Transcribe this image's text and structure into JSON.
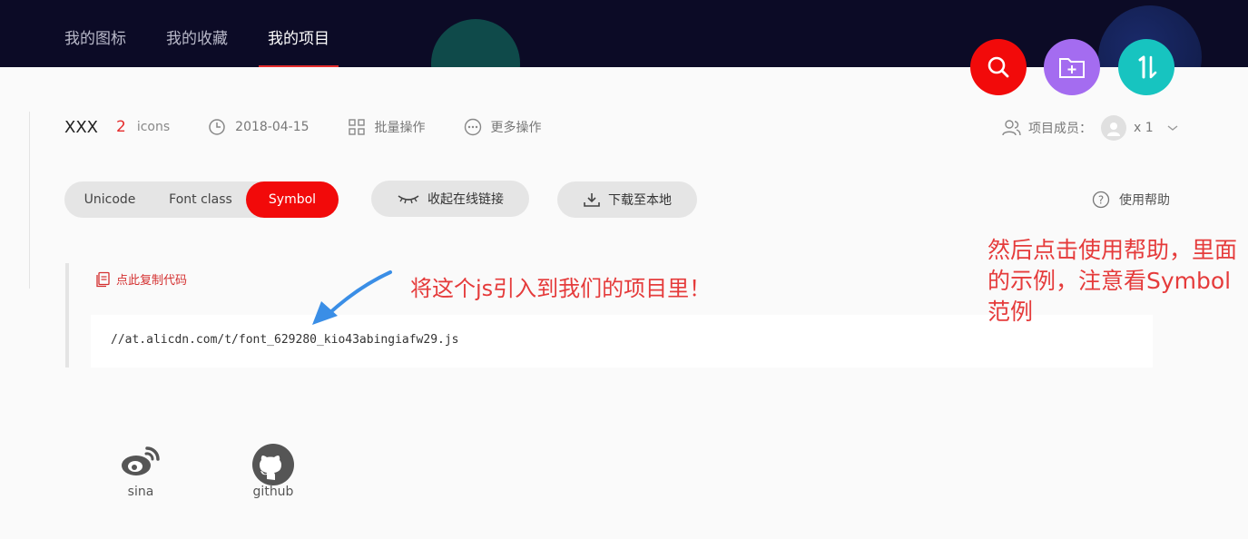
{
  "nav": {
    "items": [
      {
        "label": "我的图标"
      },
      {
        "label": "我的收藏"
      },
      {
        "label": "我的项目"
      }
    ]
  },
  "project": {
    "name": "XXX",
    "icon_count": "2",
    "icon_unit": "icons",
    "date": "2018-04-15",
    "batch_label": "批量操作",
    "more_label": "更多操作",
    "members_label": "项目成员：",
    "members_count": "x 1"
  },
  "tabs": {
    "unicode": "Unicode",
    "font_class": "Font class",
    "symbol": "Symbol"
  },
  "actions": {
    "collapse_link": "收起在线链接",
    "download": "下载至本地",
    "help": "使用帮助"
  },
  "code": {
    "copy_label": "点此复制代码",
    "url": "//at.alicdn.com/t/font_629280_kio43abingiafw29.js"
  },
  "annotations": {
    "note1": "将这个js引入到我们的项目里！",
    "note2": "然后点击使用帮助，里面的示例，注意看Symbol范例"
  },
  "footer": {
    "sina": "sina",
    "github": "github"
  },
  "colors": {
    "accent": "#f20a0a",
    "topbar": "#0c0b26",
    "annotation": "#e53b3b"
  }
}
